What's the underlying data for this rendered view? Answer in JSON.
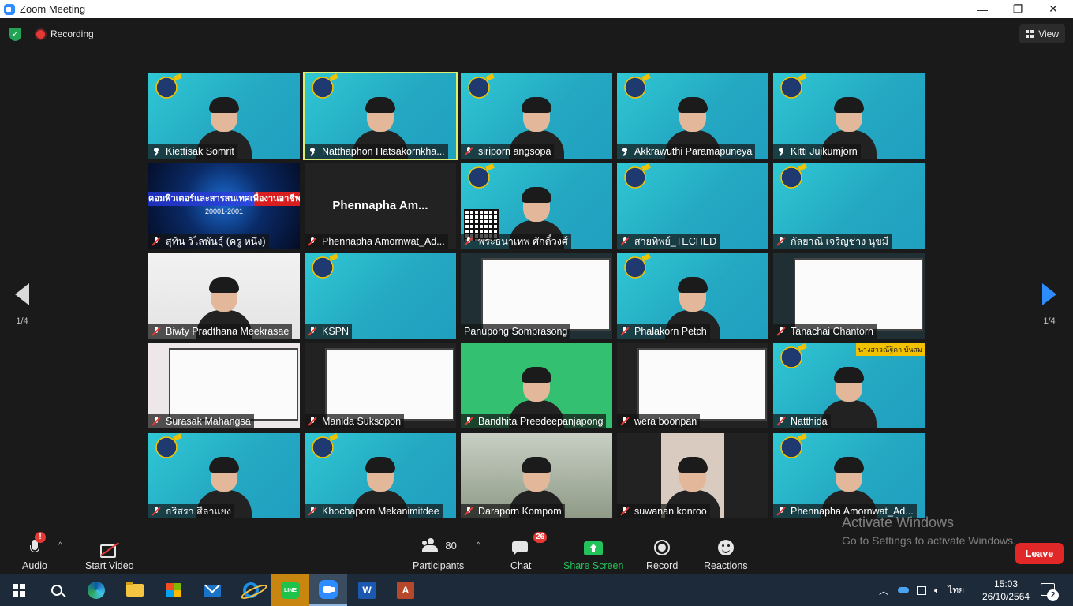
{
  "window": {
    "title": "Zoom Meeting",
    "minimize": "—",
    "maximize": "❐",
    "close": "✕"
  },
  "top": {
    "recording_label": "Recording",
    "view_label": "View"
  },
  "nav": {
    "page_left": "1/4",
    "page_right": "1/4"
  },
  "tiles": [
    {
      "name": "Kiettisak Somrit",
      "icon": "pin-icon",
      "bg": "bg-teal",
      "person": true
    },
    {
      "name": "Natthaphon Hatsakornkha...",
      "icon": "pin-icon",
      "bg": "bg-teal",
      "person": true,
      "active": true
    },
    {
      "name": "siriporn angsopa",
      "icon": "mute-icon",
      "bg": "bg-teal",
      "person": true
    },
    {
      "name": "Akkrawuthi Paramapuneya",
      "icon": "pin-icon",
      "bg": "bg-teal",
      "person": true
    },
    {
      "name": "Kitti Juikumjorn",
      "icon": "pin-icon",
      "bg": "bg-teal",
      "person": true
    },
    {
      "name": "สุทิน วิไลพันธุ์ (ครู หนึ่ง)",
      "icon": "mute-icon",
      "bg": "bg-blue",
      "banner": "คอมพิวเตอร์และสารสนเทศเพื่องานอาชีพ",
      "banner_sub": "20001-2001"
    },
    {
      "name": "Phennapha Amornwat_Ad...",
      "icon": "mute-icon",
      "bg": "bg-dark",
      "big_name": "Phennapha  Am..."
    },
    {
      "name": "พระธนาเทพ ศักดิ์วงศ์",
      "icon": "mute-icon",
      "bg": "bg-teal",
      "person": true,
      "qr": true
    },
    {
      "name": "สายทิพย์_TECHED",
      "icon": "mute-icon",
      "bg": "bg-teal"
    },
    {
      "name": "กัลยาณี เจริญช่าง นุขมี",
      "icon": "mute-icon",
      "bg": "bg-teal"
    },
    {
      "name": "Biwty Pradthana Meekrasae",
      "icon": "mute-icon",
      "bg": "bg-white",
      "person": true
    },
    {
      "name": "KSPN",
      "icon": "mute-icon",
      "bg": "bg-teal"
    },
    {
      "name": "Panupong Somprasong",
      "icon": "",
      "bg": "bg-board",
      "board": true
    },
    {
      "name": "Phalakorn Petch",
      "icon": "mute-icon",
      "bg": "bg-teal",
      "person": true
    },
    {
      "name": "Tanachai Chantorn",
      "icon": "mute-icon",
      "bg": "bg-board",
      "board": true
    },
    {
      "name": "Surasak Mahangsa",
      "icon": "mute-icon",
      "bg": "bg-pink",
      "board": true
    },
    {
      "name": "Manida Suksopon",
      "icon": "mute-icon",
      "bg": "bg-dark",
      "board": true
    },
    {
      "name": "Bandhita Preedeepanjapong",
      "icon": "mute-icon",
      "bg": "bg-green",
      "person": true
    },
    {
      "name": "wera boonpan",
      "icon": "mute-icon",
      "bg": "bg-dark",
      "board": true
    },
    {
      "name": "Natthida",
      "icon": "mute-icon",
      "bg": "bg-teal",
      "person": true,
      "corner_text": "นางสาวณัฐิดา บันสม"
    },
    {
      "name": "ธริสรา สีลาแยง",
      "icon": "mute-icon",
      "bg": "bg-teal",
      "person": true
    },
    {
      "name": "Khochaporn Mekanimitdee",
      "icon": "mute-icon",
      "bg": "bg-teal",
      "person": true
    },
    {
      "name": "Daraporn Kompom",
      "icon": "mute-icon",
      "bg": "bg-room",
      "person": true
    },
    {
      "name": "suwanan konroo",
      "icon": "mute-icon",
      "bg": "bg-dark",
      "person": true,
      "narrow": true
    },
    {
      "name": "Phennapha Amornwat_Ad...",
      "icon": "mute-icon",
      "bg": "bg-teal",
      "person": true
    }
  ],
  "toolbar": {
    "audio_label": "Audio",
    "audio_badge": "!",
    "video_label": "Start Video",
    "participants_label": "Participants",
    "participants_count": "80",
    "chat_label": "Chat",
    "chat_badge": "26",
    "share_label": "Share Screen",
    "record_label": "Record",
    "reactions_label": "Reactions",
    "leave_label": "Leave"
  },
  "watermark": {
    "line1": "Activate Windows",
    "line2": "Go to Settings to activate Windows."
  },
  "taskbar": {
    "time": "15:03",
    "date": "26/10/2564",
    "lang": "ไทย",
    "notif_count": "2",
    "line_text": "LINE",
    "word_text": "W",
    "access_text": "A"
  },
  "colors": {
    "accent": "#2d8cff",
    "share_green": "#23c35b",
    "leave_red": "#e02828",
    "active_speaker": "#dcee72"
  }
}
